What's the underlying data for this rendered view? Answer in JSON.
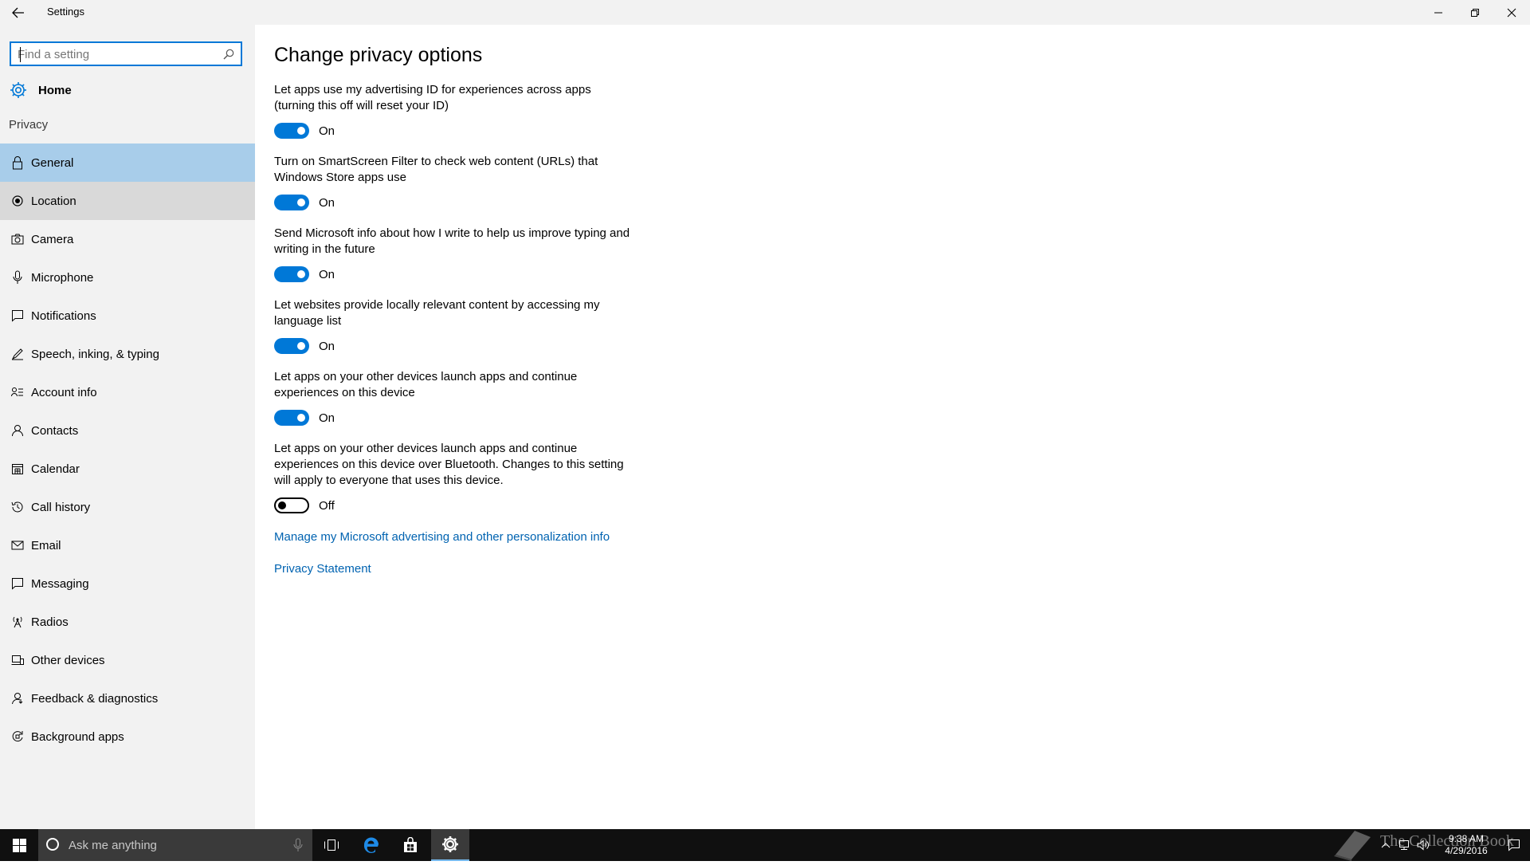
{
  "window": {
    "title": "Settings"
  },
  "sidebar": {
    "search_placeholder": "Find a setting",
    "home_label": "Home",
    "section_label": "Privacy",
    "items": [
      {
        "label": "General",
        "icon": "lock-icon",
        "state": "selected"
      },
      {
        "label": "Location",
        "icon": "location-icon",
        "state": "hovered"
      },
      {
        "label": "Camera",
        "icon": "camera-icon"
      },
      {
        "label": "Microphone",
        "icon": "microphone-icon"
      },
      {
        "label": "Notifications",
        "icon": "notifications-icon"
      },
      {
        "label": "Speech, inking, & typing",
        "icon": "speech-icon"
      },
      {
        "label": "Account info",
        "icon": "account-info-icon"
      },
      {
        "label": "Contacts",
        "icon": "contacts-icon"
      },
      {
        "label": "Calendar",
        "icon": "calendar-icon"
      },
      {
        "label": "Call history",
        "icon": "call-history-icon"
      },
      {
        "label": "Email",
        "icon": "email-icon"
      },
      {
        "label": "Messaging",
        "icon": "messaging-icon"
      },
      {
        "label": "Radios",
        "icon": "radios-icon"
      },
      {
        "label": "Other devices",
        "icon": "other-devices-icon"
      },
      {
        "label": "Feedback & diagnostics",
        "icon": "feedback-icon"
      },
      {
        "label": "Background apps",
        "icon": "background-apps-icon"
      }
    ]
  },
  "main": {
    "title": "Change privacy options",
    "settings": [
      {
        "desc": "Let apps use my advertising ID for experiences across apps (turning this off will reset your ID)",
        "on": true,
        "state_label": "On"
      },
      {
        "desc": "Turn on SmartScreen Filter to check web content (URLs) that Windows Store apps use",
        "on": true,
        "state_label": "On"
      },
      {
        "desc": "Send Microsoft info about how I write to help us improve typing and writing in the future",
        "on": true,
        "state_label": "On"
      },
      {
        "desc": "Let websites provide locally relevant content by accessing my language list",
        "on": true,
        "state_label": "On"
      },
      {
        "desc": "Let apps on your other devices launch apps and continue experiences on this device",
        "on": true,
        "state_label": "On"
      },
      {
        "desc": "Let apps on your other devices launch apps and continue experiences on this device over Bluetooth. Changes to this setting will apply to everyone that uses this device.",
        "on": false,
        "state_label": "Off"
      }
    ],
    "links": {
      "advertising": "Manage my Microsoft advertising and other personalization info",
      "privacy_statement": "Privacy Statement"
    }
  },
  "taskbar": {
    "search_placeholder": "Ask me anything",
    "apps": [
      "task-view-icon",
      "edge-icon",
      "store-icon",
      "settings-icon"
    ],
    "active_app": "settings-icon",
    "time": "9:38 AM",
    "date": "4/29/2016",
    "watermark": "The Collection Book"
  },
  "colors": {
    "accent": "#0078d7",
    "selected_nav": "#a8cdea",
    "hover_nav": "#d9d9d9",
    "link": "#0063b1",
    "taskbar": "#101010"
  }
}
